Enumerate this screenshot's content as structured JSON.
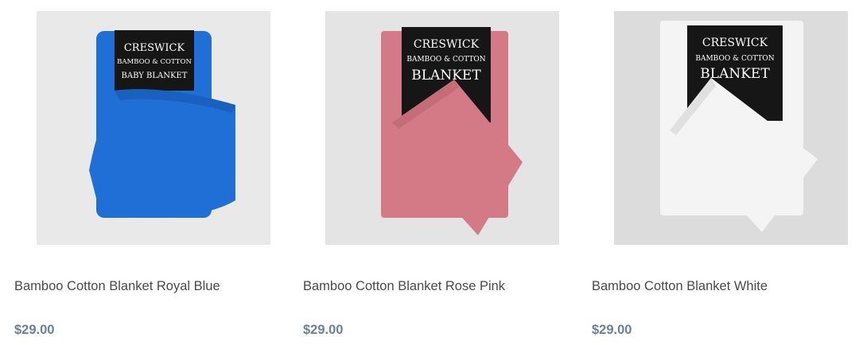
{
  "products": [
    {
      "title": "Bamboo Cotton Blanket Royal Blue",
      "price": "$29.00",
      "image": {
        "bg": "#e9e9e9",
        "fabric": "#1f6fd6",
        "fabric_dark": "#1657b3",
        "label_lines": [
          "CRESWICK",
          "BAMBOO & COTTON",
          "BABY BLANKET"
        ]
      }
    },
    {
      "title": "Bamboo Cotton Blanket Rose Pink",
      "price": "$29.00",
      "image": {
        "bg": "#e4e4e4",
        "fabric": "#d47a86",
        "fabric_dark": "#b9626f",
        "label_lines": [
          "CRESWICK",
          "BAMBOO & COTTON",
          "BLANKET"
        ]
      }
    },
    {
      "title": "Bamboo Cotton Blanket White",
      "price": "$29.00",
      "image": {
        "bg": "#dcdcdc",
        "fabric": "#f4f4f4",
        "fabric_dark": "#d2d2d2",
        "label_lines": [
          "CRESWICK",
          "BAMBOO & COTTON",
          "BLANKET"
        ]
      }
    }
  ]
}
